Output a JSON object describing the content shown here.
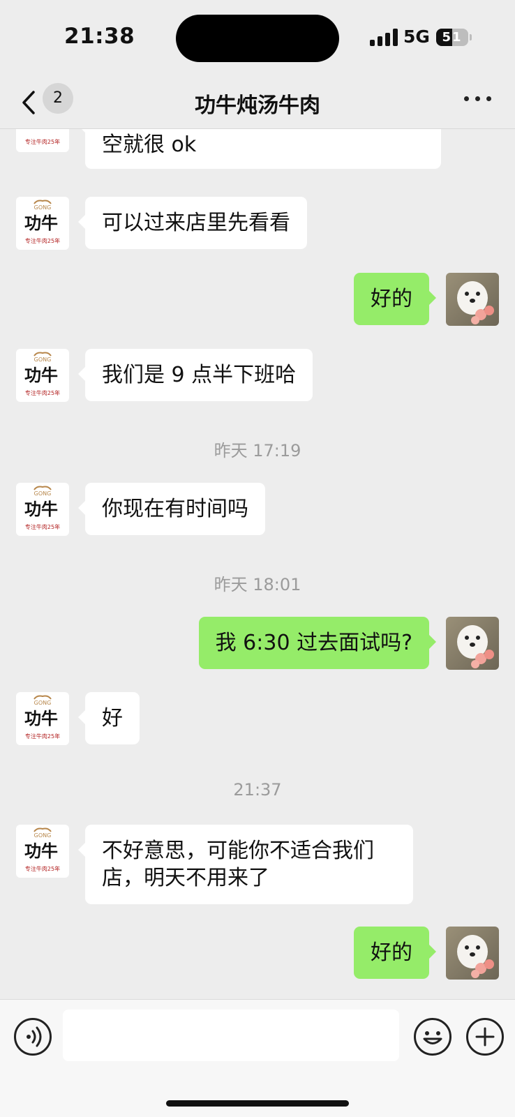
{
  "status_bar": {
    "time": "21:38",
    "network": "5G",
    "battery": "51",
    "battery_level": 0.51
  },
  "nav": {
    "unread_count": "2",
    "title": "功牛炖汤牛肉"
  },
  "messages": [
    {
      "type": "in",
      "text": "空就很 ok"
    },
    {
      "type": "in",
      "text": "可以过来店里先看看"
    },
    {
      "type": "out",
      "text": "好的"
    },
    {
      "type": "in",
      "text": "我们是 9 点半下班哈"
    },
    {
      "type": "time",
      "text": "昨天 17:19"
    },
    {
      "type": "in",
      "text": "你现在有时间吗"
    },
    {
      "type": "time",
      "text": "昨天 18:01"
    },
    {
      "type": "out",
      "text": "我 6:30 过去面试吗?"
    },
    {
      "type": "in",
      "text": "好"
    },
    {
      "type": "time",
      "text": "21:37"
    },
    {
      "type": "in",
      "text": "不好意思，可能你不适合我们店，明天不用来了"
    },
    {
      "type": "out",
      "text": "好的"
    }
  ],
  "contact_logo": {
    "brand": "功牛",
    "sub": "专注牛肉25年"
  },
  "icons": [
    "back-icon",
    "more-icon",
    "voice-icon",
    "emoji-icon",
    "plus-icon"
  ],
  "colors": {
    "outgoing_bubble": "#95ec69",
    "incoming_bubble": "#ffffff",
    "background": "#ededed"
  }
}
